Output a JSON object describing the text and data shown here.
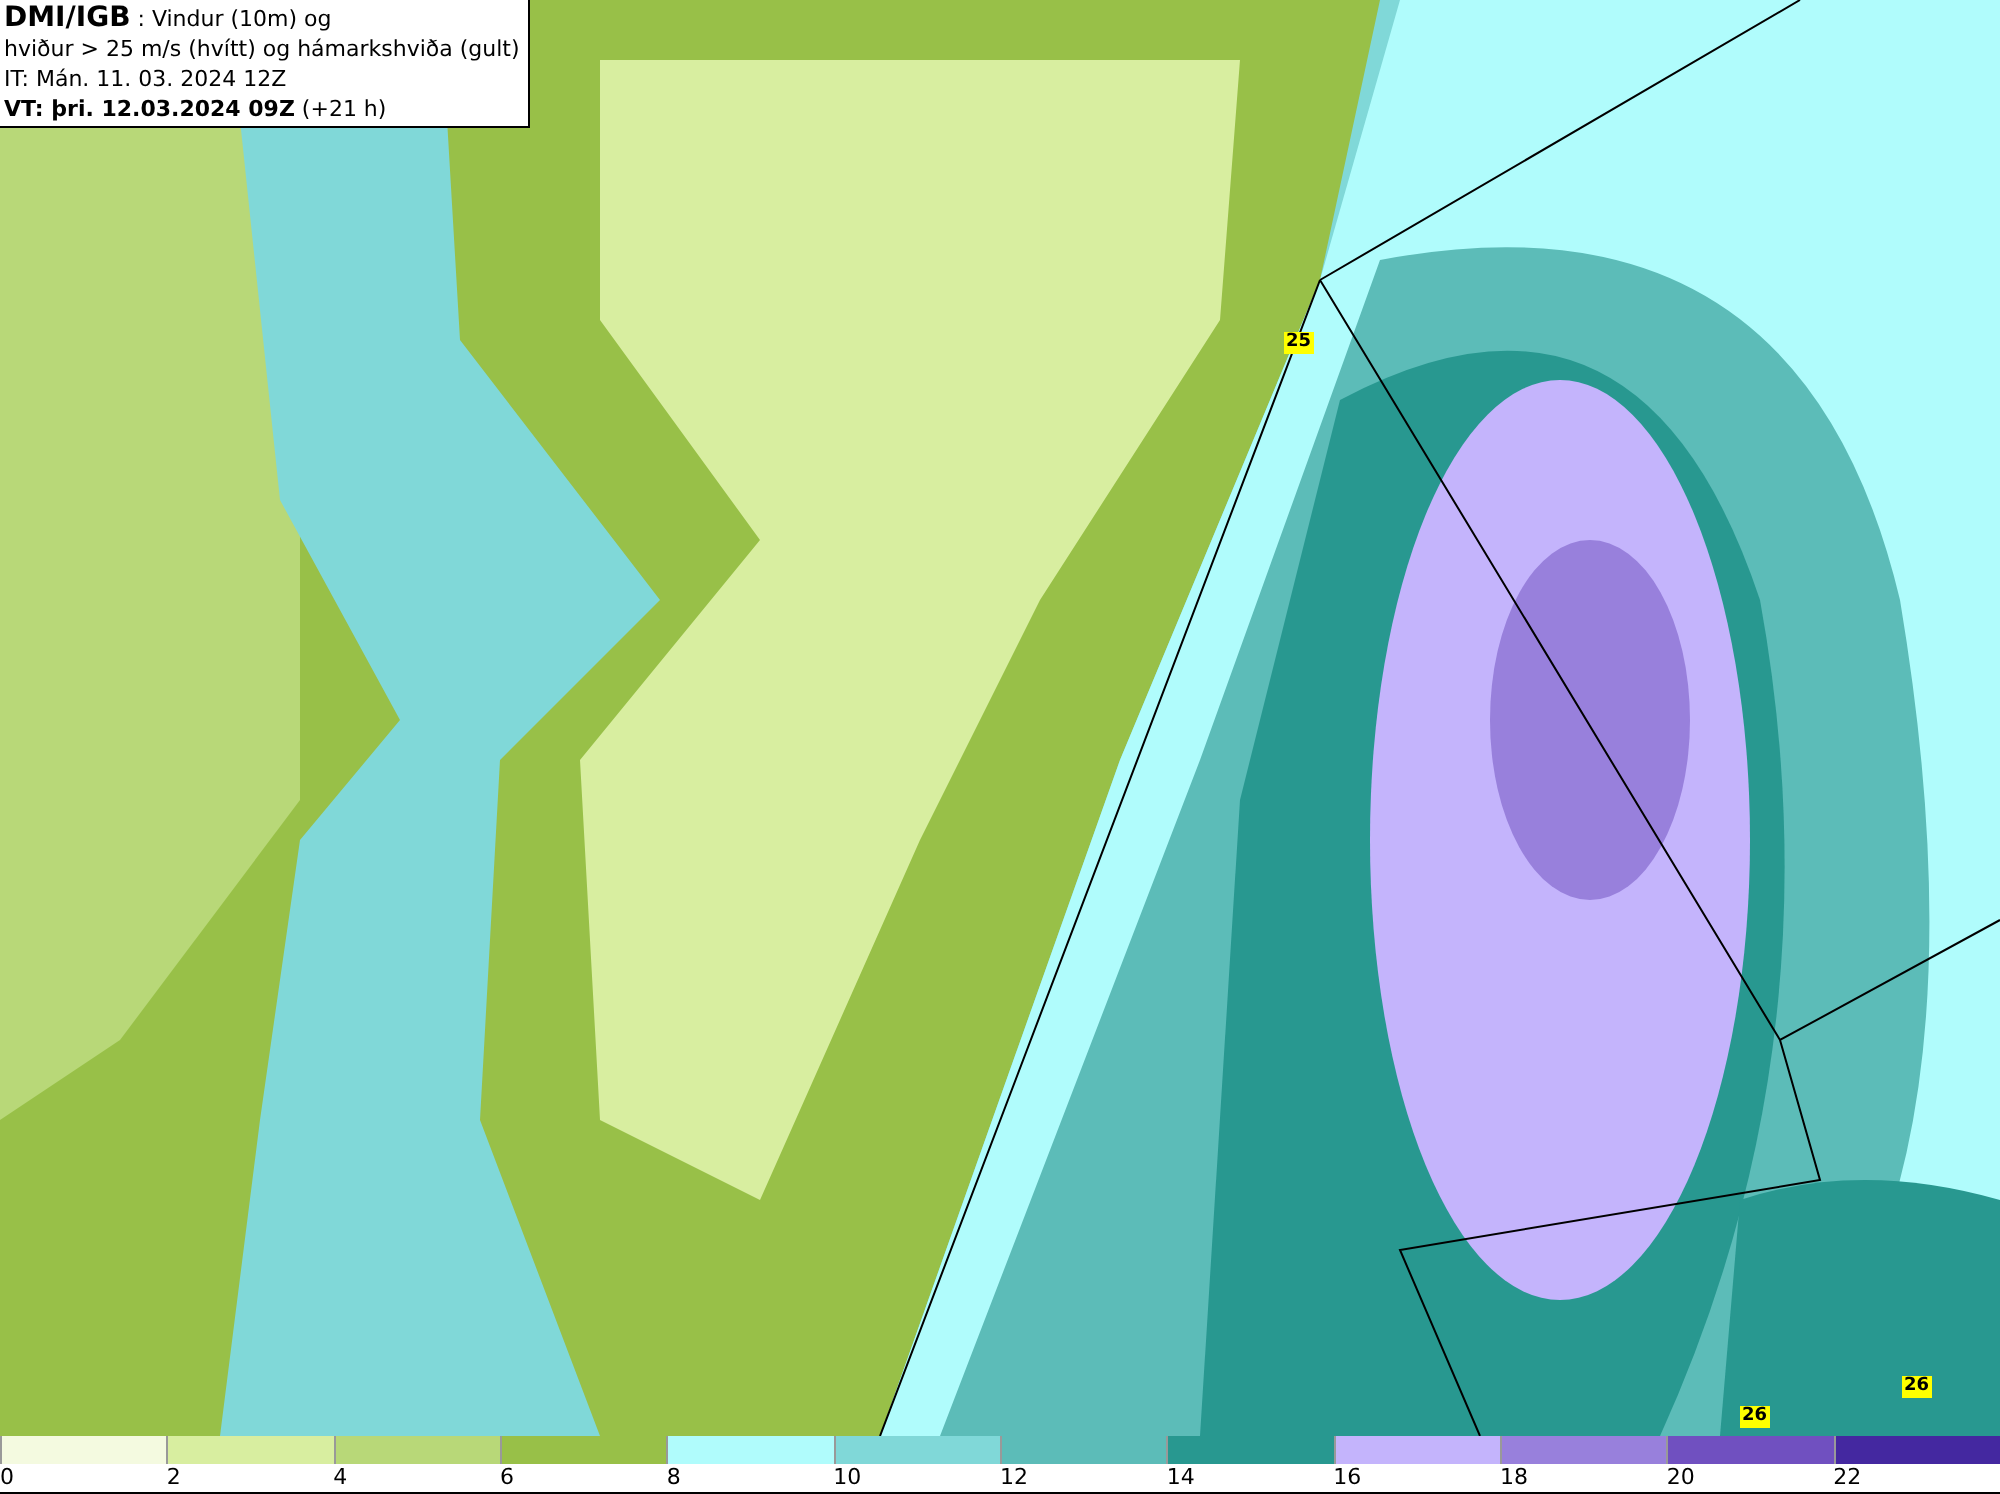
{
  "title_box": {
    "lines": [
      "**DMI/IGB** : Vindur (10m) og",
      "hviður > 25 m/s (hvítt) og hámarkshviða (gult)",
      "IT: Mán. 11. 03. 2024 12Z",
      "**VT: þri. 12.03.2024 09Z** (+21 h)"
    ]
  },
  "badges": [
    {
      "text": "25"
    },
    {
      "text": "26"
    },
    {
      "text": "26"
    }
  ],
  "legend": {
    "bins": [
      {
        "label": "0",
        "color": "#f4fae0"
      },
      {
        "label": "2",
        "color": "#d8eea0"
      },
      {
        "label": "4",
        "color": "#b8d878"
      },
      {
        "label": "6",
        "color": "#98c048"
      },
      {
        "label": "8",
        "color": "#b0fcfc"
      },
      {
        "label": "10",
        "color": "#80d8d8"
      },
      {
        "label": "12",
        "color": "#5cbcb8"
      },
      {
        "label": "14",
        "color": "#289890"
      },
      {
        "label": "16",
        "color": "#c4b4fc"
      },
      {
        "label": "18",
        "color": "#9880dc"
      },
      {
        "label": "20",
        "color": "#7050c0"
      },
      {
        "label": "22",
        "color": "#4428a0"
      }
    ]
  }
}
